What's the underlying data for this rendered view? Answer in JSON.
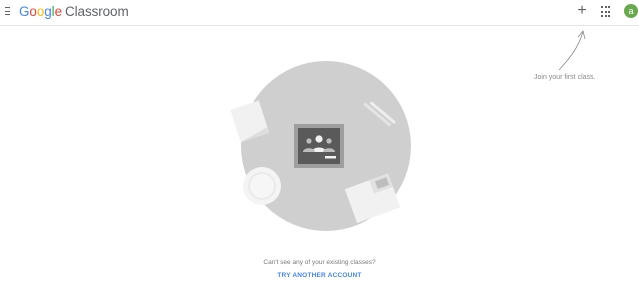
{
  "header": {
    "brand_letters": [
      {
        "char": "G",
        "color": "#4285f4"
      },
      {
        "char": "o",
        "color": "#ea4335"
      },
      {
        "char": "o",
        "color": "#fbbc05"
      },
      {
        "char": "g",
        "color": "#4285f4"
      },
      {
        "char": "l",
        "color": "#34a853"
      },
      {
        "char": "e",
        "color": "#ea4335"
      }
    ],
    "product": "Classroom",
    "plus_symbol": "+",
    "avatar_initial": "a",
    "avatar_color": "#6aa84f",
    "icons": [
      "menu-icon",
      "plus-icon",
      "apps-grid-icon"
    ]
  },
  "hint": {
    "join_text": "Join your first class."
  },
  "empty_state": {
    "cant_see_text": "Can't see any of your existing classes?",
    "try_another_label": "TRY ANOTHER ACCOUNT"
  },
  "colors": {
    "link": "#4285f4",
    "circle": "#cfcfcf"
  }
}
